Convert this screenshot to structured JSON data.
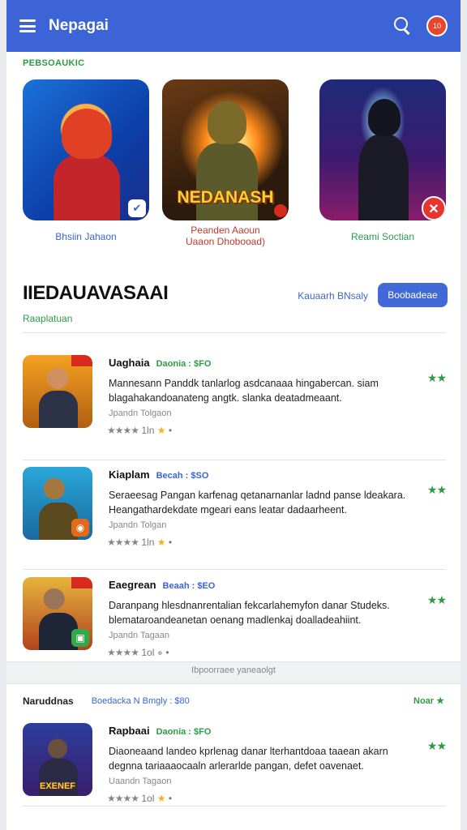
{
  "app": {
    "title": "Nepagai",
    "notification_count": "10"
  },
  "featured": {
    "section_label": "PEBSOAUKIC",
    "items": [
      {
        "caption": "Bhsiin Jahaon",
        "caption_color": "#3d64d6"
      },
      {
        "caption_line1": "Peanden Aaoun",
        "caption_line2": "Uaaon Dhobooad)",
        "tile_text": "NEDANASH",
        "caption_color": "#c0392b"
      },
      {
        "caption": "Reami Soctian",
        "caption_color": "#2e9b47"
      }
    ]
  },
  "list": {
    "title": "IIEDAUAVASAAI",
    "subtitle": "Raaplatuan",
    "link_label": "Kauaarh BNsaly",
    "button_label": "Boobadeae",
    "items": [
      {
        "title": "Uaghaia",
        "tag": "Daonia : $FO",
        "desc_line1": "Mannesann Panddk tanlarlog asdcanaaa hingabercan. siam",
        "desc_line2": "blagahakandoanateng angtk. slanka deatadmeaant.",
        "meta": "Jpandn Tolgaon",
        "stars": "★★★★",
        "rating_text": "1ln",
        "dot_label": "•",
        "badge_text": "★★"
      },
      {
        "title": "Kiaplam",
        "tag": "Becah : $SO",
        "desc_line1": "Seraeesag Pangan karfenag qetanarnanlar ladnd panse ldeakara.",
        "desc_line2": "Heangathardekdate mgeari eans leatar dadaarheent.",
        "meta": "Jpandn Tolgan",
        "stars": "★★★★",
        "rating_text": "1ln",
        "dot_label": "•",
        "badge_text": "★★"
      },
      {
        "title": "Eaegrean",
        "tag": "Beaah : $EO",
        "desc_line1": "Daranpang hlesdnanrentalian fekcarlahemyfon danar Studeks.",
        "desc_line2": "blemataroandeanetan oenang madlenkaj doalladeahiint.",
        "meta": "Jpandn Tagaan",
        "stars": "★★★★",
        "rating_text": "1ol",
        "dot_label": "•",
        "badge_text": "★★"
      }
    ]
  },
  "band": {
    "hint": "Ibpoorraee yaneaolgt",
    "title": "Naruddnas",
    "filter": "Boedacka N Bmgly : $80",
    "more": "Noar ★"
  },
  "last_item": {
    "title": "Rapbaai",
    "tag": "Daonia : $FO",
    "desc_line1": "Diaoneaand landeo kprlenag danar lterhantdoaa taaean akarn",
    "desc_line2": "degnna tariaaaocaaln arlerarlde pangan, defet oavenaet.",
    "meta": "Uaandn Tagaon",
    "stars": "★★★★",
    "rating_text": "1ol",
    "dot_label": "•",
    "badge_text": "★★",
    "thumb_text": "EXENEF"
  }
}
